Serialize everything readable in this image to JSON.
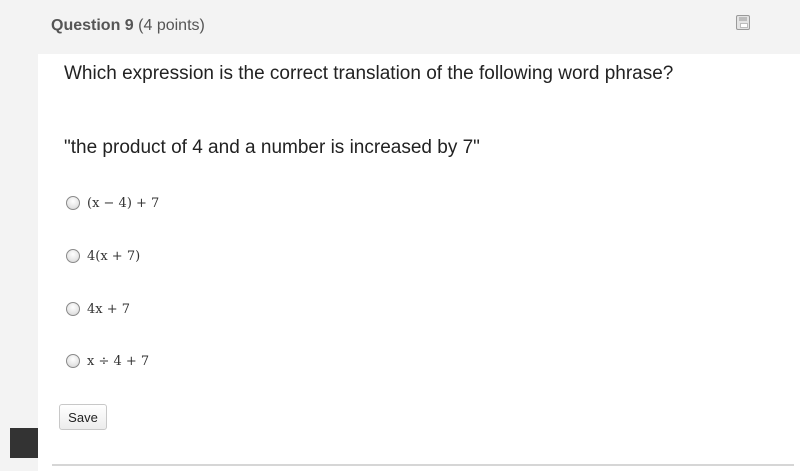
{
  "question": {
    "number_label": "Question 9",
    "points_label": "(4 points)",
    "prompt": "Which expression is the correct translation of the following word phrase?",
    "phrase": "\"the product of 4 and a number is increased by 7\""
  },
  "options": [
    {
      "label": "(x − 4) + 7"
    },
    {
      "label": "4(x + 7)"
    },
    {
      "label": "4x + 7"
    },
    {
      "label": "x ÷ 4 + 7"
    }
  ],
  "actions": {
    "save_label": "Save"
  },
  "icons": {
    "flag": "save-flag-icon"
  },
  "colors": {
    "header_bg": "#f3f3f3",
    "text": "#222222",
    "muted": "#555555"
  }
}
